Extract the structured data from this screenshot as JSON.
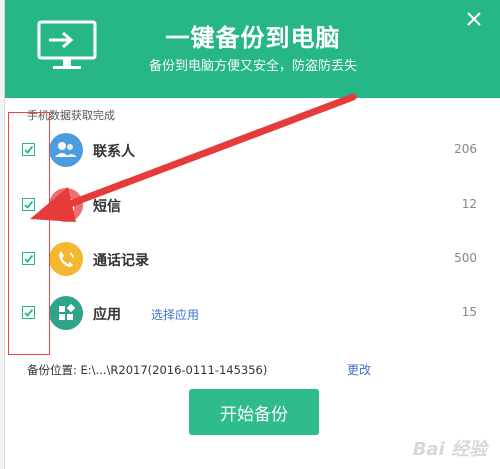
{
  "header": {
    "title": "一键备份到电脑",
    "subtitle": "备份到电脑方便又安全，防盗防丢失",
    "color": "#27b787"
  },
  "status": "手机数据获取完成",
  "items": [
    {
      "name": "联系人",
      "count": "206",
      "icon": "contacts-icon",
      "color": "#4a9ee0",
      "checked": true
    },
    {
      "name": "短信",
      "count": "12",
      "icon": "sms-icon",
      "color": "#ee6f6f",
      "checked": true
    },
    {
      "name": "通话记录",
      "count": "500",
      "icon": "phone-icon",
      "color": "#f5b630",
      "checked": true
    },
    {
      "name": "应用",
      "count": "15",
      "icon": "apps-icon",
      "color": "#2fa48a",
      "checked": true,
      "link": "选择应用"
    }
  ],
  "location": {
    "label": "备份位置: E:\\...\\R2017(2016-0111-145356)",
    "change": "更改"
  },
  "start_button": "开始备份",
  "watermark": "Bai 经验"
}
